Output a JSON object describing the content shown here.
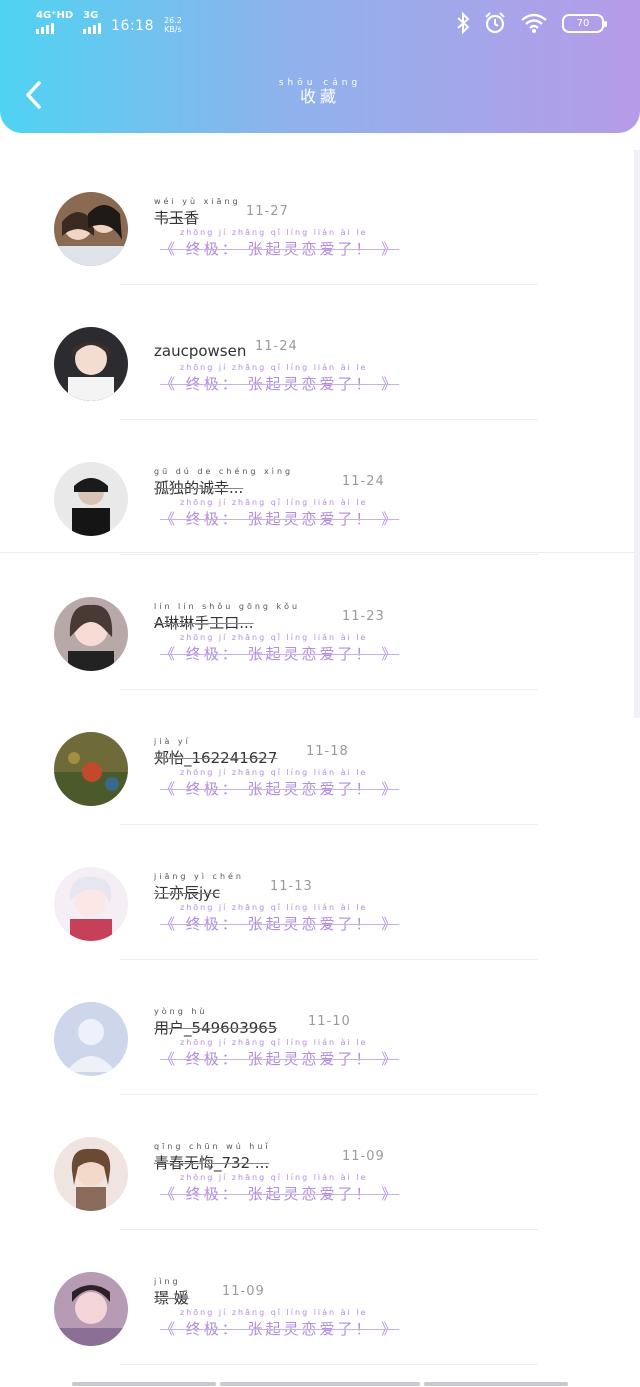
{
  "status_bar": {
    "sim1_label": "4G⁺HD",
    "sim2_label": "3G",
    "time": "16:18",
    "speed_value": "26.2",
    "speed_unit": "KB/s",
    "battery": "70"
  },
  "header": {
    "title_pinyin": "shōu cáng",
    "title": "收藏"
  },
  "quote": {
    "pinyin": "zhōng  jí    zhāng  qǐ  líng lián  ài  le",
    "text": "《 终极： 张起灵恋爱了！ 》"
  },
  "favorites": [
    {
      "name_pinyin": "wéi  yù xiāng",
      "name": "韦玉香",
      "date": "11-27",
      "avatar": "couple-photo"
    },
    {
      "name_pinyin": "",
      "name": "zaucpowsen",
      "date": "11-24",
      "avatar": "boy-photo"
    },
    {
      "name_pinyin": "gū  dú  de chéng xìng",
      "name": "孤独的诚幸...",
      "date": "11-24",
      "avatar": "cap-photo"
    },
    {
      "name_pinyin": "lín lín shǒu gōng kǒu",
      "name": "A琳琳手工口...",
      "date": "11-23",
      "avatar": "girl-photo"
    },
    {
      "name_pinyin": "jià  yí",
      "name": "郏怡_162241627",
      "date": "11-18",
      "avatar": "game-photo"
    },
    {
      "name_pinyin": "jiāng yì chén",
      "name": "江亦辰jyc",
      "date": "11-13",
      "avatar": "anime-photo"
    },
    {
      "name_pinyin": "yòng hù",
      "name": "用户_549603965",
      "date": "11-10",
      "avatar": "default-avatar"
    },
    {
      "name_pinyin": "qīng chūn wú huǐ",
      "name": "青春无悔_732 ...",
      "date": "11-09",
      "avatar": "doll-photo"
    },
    {
      "name_pinyin": "jìng",
      "name": "璟 媛",
      "date": "11-09",
      "avatar": "selfie-photo"
    }
  ],
  "colors": {
    "header_start": "#4fd3f2",
    "header_end": "#b69be8",
    "quote": "#b38de0"
  }
}
